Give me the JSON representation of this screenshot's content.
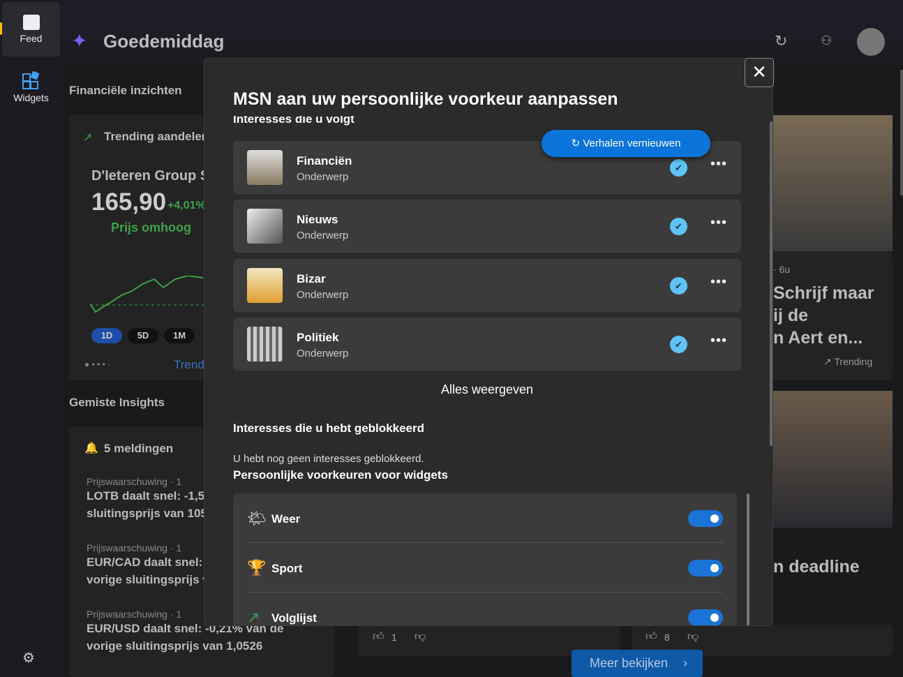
{
  "nav": {
    "feed": "Feed",
    "widgets": "Widgets"
  },
  "header": {
    "greeting": "Goedemiddag"
  },
  "financial": {
    "title": "Financiële inzichten",
    "trending_title": "Trending aandelen",
    "stock_name": "D'Ieteren Group S",
    "price": "165,90",
    "change": "+4,01%",
    "status": "Prijs omhoog",
    "ranges": [
      "1D",
      "5D",
      "1M"
    ],
    "link": "Trend"
  },
  "missed": {
    "title": "Gemiste Insights",
    "count": "5 meldingen",
    "alerts": [
      {
        "source": "Prijswaarschuwing · 1",
        "line1": "LOTB daalt snel: -1,52",
        "line2": "sluitingsprijs van 105"
      },
      {
        "source": "Prijswaarschuwing · 1",
        "line1": "EUR/CAD daalt snel: -",
        "line2": "vorige sluitingsprijs v"
      },
      {
        "source": "Prijswaarschuwing · 1",
        "line1": "EUR/USD daalt snel: -0,21% van de",
        "line2": "vorige sluitingsprijs van 1,0526"
      }
    ]
  },
  "news": {
    "meta": "· 6u",
    "headline1": "Schrijf maar",
    "headline2": "ij de",
    "headline3": "n Aert en...",
    "trending": "Trending",
    "headline_b": "n deadline",
    "likes_a": "1",
    "likes_b": "8",
    "more": "Meer bekijken"
  },
  "modal": {
    "title": "MSN aan uw persoonlijke voorkeur aanpassen",
    "followed_heading": "Interesses die u volgt",
    "refresh": "Verhalen vernieuwen",
    "topics": [
      {
        "name": "Financiën",
        "type": "Onderwerp"
      },
      {
        "name": "Nieuws",
        "type": "Onderwerp"
      },
      {
        "name": "Bizar",
        "type": "Onderwerp"
      },
      {
        "name": "Politiek",
        "type": "Onderwerp"
      }
    ],
    "show_all": "Alles weergeven",
    "blocked_heading": "Interesses die u hebt geblokkeerd",
    "blocked_empty": "U hebt nog geen interesses geblokkeerd.",
    "widgets_heading": "Persoonlijke voorkeuren voor widgets",
    "widgets": [
      {
        "name": "Weer",
        "on": true
      },
      {
        "name": "Sport",
        "on": true
      },
      {
        "name": "Volglijst",
        "on": true
      }
    ]
  },
  "colors": {
    "accent": "#0a74da",
    "check": "#5fc4f5",
    "green": "#3fa14a"
  }
}
